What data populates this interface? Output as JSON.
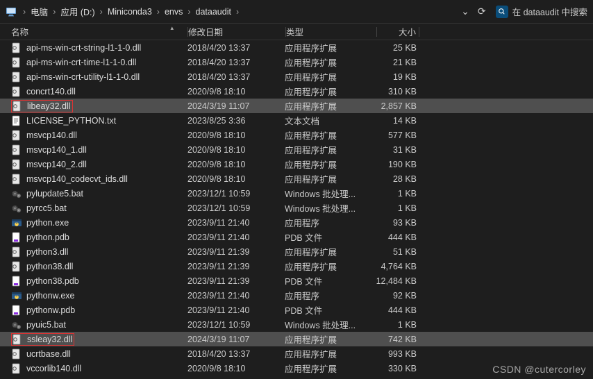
{
  "toolbar": {
    "crumbs": [
      "电脑",
      "应用 (D:)",
      "Miniconda3",
      "envs",
      "dataaudit"
    ],
    "chevron_down": "⌄",
    "refresh": "⟳",
    "search_prefix": "在",
    "search_name": "dataaudit",
    "search_suffix": "中搜索"
  },
  "headers": {
    "name": "名称",
    "date": "修改日期",
    "type": "类型",
    "size": "大小",
    "sort_glyph": "▴"
  },
  "icons": {
    "dll": "dll",
    "txt": "txt",
    "bat": "bat",
    "exe": "exe",
    "pdb": "pdb"
  },
  "files": [
    {
      "name": "api-ms-win-crt-string-l1-1-0.dll",
      "date": "2018/4/20 13:37",
      "type": "应用程序扩展",
      "size": "25 KB",
      "icon": "dll"
    },
    {
      "name": "api-ms-win-crt-time-l1-1-0.dll",
      "date": "2018/4/20 13:37",
      "type": "应用程序扩展",
      "size": "21 KB",
      "icon": "dll"
    },
    {
      "name": "api-ms-win-crt-utility-l1-1-0.dll",
      "date": "2018/4/20 13:37",
      "type": "应用程序扩展",
      "size": "19 KB",
      "icon": "dll"
    },
    {
      "name": "concrt140.dll",
      "date": "2020/9/8 18:10",
      "type": "应用程序扩展",
      "size": "310 KB",
      "icon": "dll"
    },
    {
      "name": "libeay32.dll",
      "date": "2024/3/19 11:07",
      "type": "应用程序扩展",
      "size": "2,857 KB",
      "icon": "dll",
      "highlight": true,
      "red": true
    },
    {
      "name": "LICENSE_PYTHON.txt",
      "date": "2023/8/25 3:36",
      "type": "文本文档",
      "size": "14 KB",
      "icon": "txt"
    },
    {
      "name": "msvcp140.dll",
      "date": "2020/9/8 18:10",
      "type": "应用程序扩展",
      "size": "577 KB",
      "icon": "dll"
    },
    {
      "name": "msvcp140_1.dll",
      "date": "2020/9/8 18:10",
      "type": "应用程序扩展",
      "size": "31 KB",
      "icon": "dll"
    },
    {
      "name": "msvcp140_2.dll",
      "date": "2020/9/8 18:10",
      "type": "应用程序扩展",
      "size": "190 KB",
      "icon": "dll"
    },
    {
      "name": "msvcp140_codecvt_ids.dll",
      "date": "2020/9/8 18:10",
      "type": "应用程序扩展",
      "size": "28 KB",
      "icon": "dll"
    },
    {
      "name": "pylupdate5.bat",
      "date": "2023/12/1 10:59",
      "type": "Windows 批处理...",
      "size": "1 KB",
      "icon": "bat"
    },
    {
      "name": "pyrcc5.bat",
      "date": "2023/12/1 10:59",
      "type": "Windows 批处理...",
      "size": "1 KB",
      "icon": "bat"
    },
    {
      "name": "python.exe",
      "date": "2023/9/11 21:40",
      "type": "应用程序",
      "size": "93 KB",
      "icon": "exe"
    },
    {
      "name": "python.pdb",
      "date": "2023/9/11 21:40",
      "type": "PDB 文件",
      "size": "444 KB",
      "icon": "pdb"
    },
    {
      "name": "python3.dll",
      "date": "2023/9/11 21:39",
      "type": "应用程序扩展",
      "size": "51 KB",
      "icon": "dll"
    },
    {
      "name": "python38.dll",
      "date": "2023/9/11 21:39",
      "type": "应用程序扩展",
      "size": "4,764 KB",
      "icon": "dll"
    },
    {
      "name": "python38.pdb",
      "date": "2023/9/11 21:39",
      "type": "PDB 文件",
      "size": "12,484 KB",
      "icon": "pdb"
    },
    {
      "name": "pythonw.exe",
      "date": "2023/9/11 21:40",
      "type": "应用程序",
      "size": "92 KB",
      "icon": "exe"
    },
    {
      "name": "pythonw.pdb",
      "date": "2023/9/11 21:40",
      "type": "PDB 文件",
      "size": "444 KB",
      "icon": "pdb"
    },
    {
      "name": "pyuic5.bat",
      "date": "2023/12/1 10:59",
      "type": "Windows 批处理...",
      "size": "1 KB",
      "icon": "bat"
    },
    {
      "name": "ssleay32.dll",
      "date": "2024/3/19 11:07",
      "type": "应用程序扩展",
      "size": "742 KB",
      "icon": "dll",
      "highlight": true,
      "red": true
    },
    {
      "name": "ucrtbase.dll",
      "date": "2018/4/20 13:37",
      "type": "应用程序扩展",
      "size": "993 KB",
      "icon": "dll"
    },
    {
      "name": "vccorlib140.dll",
      "date": "2020/9/8 18:10",
      "type": "应用程序扩展",
      "size": "330 KB",
      "icon": "dll"
    }
  ],
  "watermark": "CSDN @cutercorley"
}
